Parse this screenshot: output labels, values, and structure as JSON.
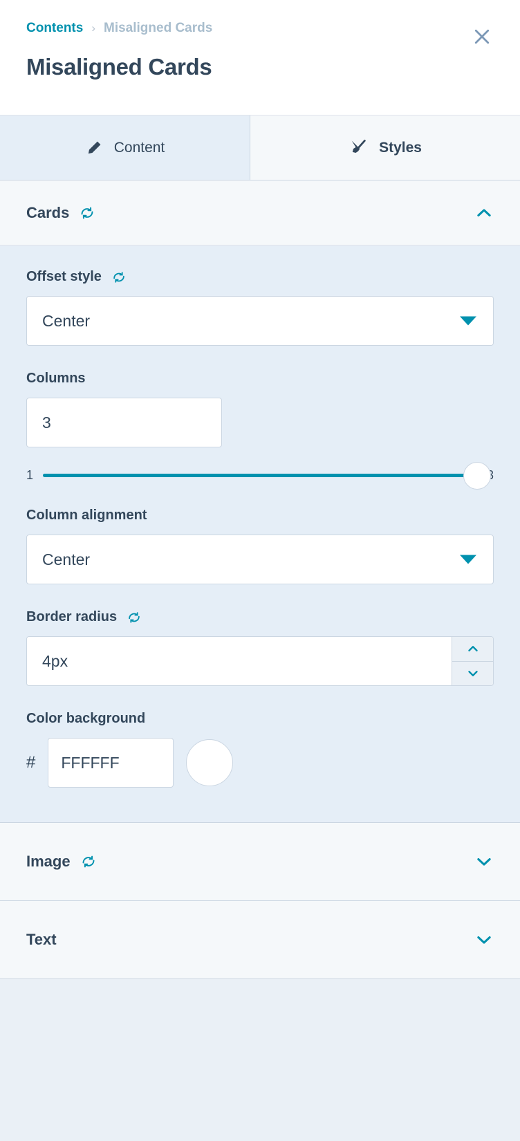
{
  "header": {
    "breadcrumb": {
      "root": "Contents",
      "separator": "›",
      "current": "Misaligned Cards"
    },
    "title": "Misaligned Cards",
    "close_icon": "close-icon"
  },
  "tabs": [
    {
      "label": "Content",
      "icon": "pencil-icon",
      "active": false
    },
    {
      "label": "Styles",
      "icon": "paintbrush-icon",
      "active": true
    }
  ],
  "sections": {
    "cards": {
      "title": "Cards",
      "refresh_icon": "refresh-icon",
      "chevron": "chevron-up-icon",
      "expanded": true,
      "fields": {
        "offset_style": {
          "label": "Offset style",
          "has_refresh": true,
          "value": "Center"
        },
        "columns": {
          "label": "Columns",
          "has_refresh": false,
          "value": "3",
          "slider": {
            "min": "1",
            "max": "3",
            "value": 3,
            "percent": 100
          }
        },
        "column_alignment": {
          "label": "Column alignment",
          "has_refresh": false,
          "value": "Center"
        },
        "border_radius": {
          "label": "Border radius",
          "has_refresh": true,
          "value": "4px",
          "up_icon": "chevron-up-icon",
          "down_icon": "chevron-down-icon"
        },
        "color_background": {
          "label": "Color background",
          "has_refresh": false,
          "hash": "#",
          "value": "FFFFFF",
          "swatch_color": "#FFFFFF"
        }
      }
    },
    "image": {
      "title": "Image",
      "refresh_icon": "refresh-icon",
      "has_refresh": true,
      "chevron": "chevron-down-icon",
      "expanded": false
    },
    "text": {
      "title": "Text",
      "has_refresh": false,
      "chevron": "chevron-down-icon",
      "expanded": false
    }
  },
  "colors": {
    "accent": "#0091ae",
    "text": "#33475b",
    "muted": "#a8bdcd",
    "border": "#cbd6e2",
    "panel_bg": "#e5eef7",
    "section_bg": "#f5f8fa"
  }
}
